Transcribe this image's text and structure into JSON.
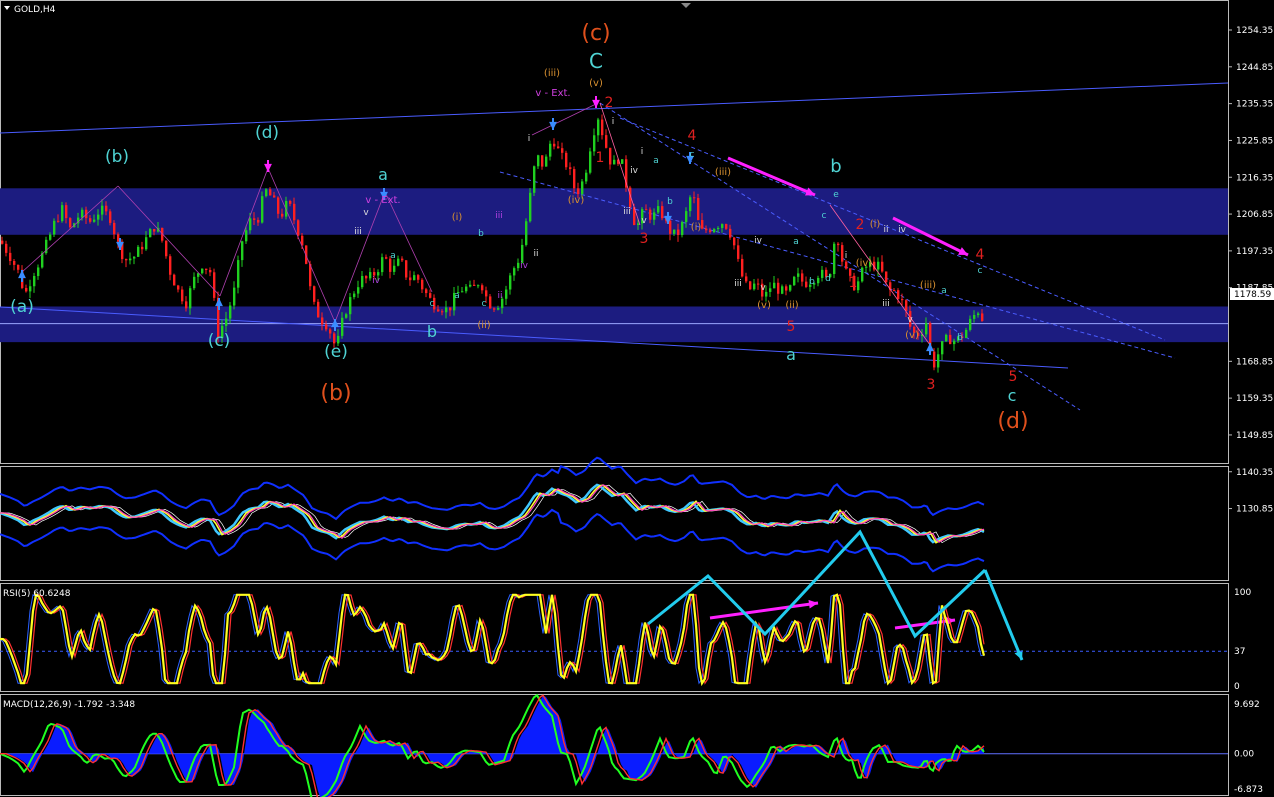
{
  "window": {
    "symbol_label": "GOLD,H4",
    "current_price_label": "1178.59"
  },
  "colors": {
    "background": "#000000",
    "bull_candle": "#20d020",
    "bear_candle": "#ff2020",
    "zone": "#1c1c80",
    "channel": "#4a5cff",
    "arrow_magenta": "#ff20ff",
    "arrow_cyan": "#22ccee",
    "label_cyan": "#4fd3d3",
    "label_orange": "#e0501c",
    "label_red": "#e02020",
    "label_gold": "#d89030",
    "rsi_line": "#ffff20",
    "macd_hist": "#0a1cff"
  },
  "chart_data": [
    {
      "type": "candlestick",
      "panel": "main",
      "symbol": "GOLD",
      "timeframe": "H4",
      "price_ticks": [
        "1254.35",
        "1244.85",
        "1235.35",
        "1225.85",
        "1216.35",
        "1206.85",
        "1197.35",
        "1187.85",
        "1178.59",
        "1168.85",
        "1159.35",
        "1149.85",
        "1140.35",
        "1130.85"
      ],
      "ylim": [
        1130.85,
        1259.0
      ],
      "current_price": 1178.59,
      "close_path": [
        [
          0,
          1200
        ],
        [
          10,
          1196
        ],
        [
          18,
          1192
        ],
        [
          25,
          1186
        ],
        [
          32,
          1191
        ],
        [
          40,
          1195
        ],
        [
          48,
          1200
        ],
        [
          55,
          1205
        ],
        [
          62,
          1208
        ],
        [
          70,
          1203
        ],
        [
          80,
          1207
        ],
        [
          90,
          1205
        ],
        [
          100,
          1208
        ],
        [
          110,
          1206
        ],
        [
          118,
          1199
        ],
        [
          125,
          1195
        ],
        [
          135,
          1196
        ],
        [
          145,
          1200
        ],
        [
          155,
          1204
        ],
        [
          162,
          1200
        ],
        [
          170,
          1192
        ],
        [
          178,
          1187
        ],
        [
          186,
          1184
        ],
        [
          194,
          1190
        ],
        [
          202,
          1194
        ],
        [
          210,
          1192
        ],
        [
          218,
          1176
        ],
        [
          226,
          1180
        ],
        [
          234,
          1187
        ],
        [
          242,
          1200
        ],
        [
          250,
          1205
        ],
        [
          258,
          1206
        ],
        [
          265,
          1213
        ],
        [
          272,
          1211
        ],
        [
          280,
          1206
        ],
        [
          288,
          1210
        ],
        [
          296,
          1204
        ],
        [
          304,
          1198
        ],
        [
          312,
          1184
        ],
        [
          320,
          1180
        ],
        [
          328,
          1178
        ],
        [
          336,
          1172
        ],
        [
          344,
          1181
        ],
        [
          352,
          1186
        ],
        [
          360,
          1190
        ],
        [
          368,
          1190
        ],
        [
          376,
          1192
        ],
        [
          384,
          1196
        ],
        [
          392,
          1192
        ],
        [
          400,
          1195
        ],
        [
          408,
          1190
        ],
        [
          416,
          1191
        ],
        [
          424,
          1187
        ],
        [
          432,
          1184
        ],
        [
          440,
          1183
        ],
        [
          448,
          1182
        ],
        [
          456,
          1186
        ],
        [
          464,
          1188
        ],
        [
          472,
          1187
        ],
        [
          480,
          1190
        ],
        [
          488,
          1184
        ],
        [
          496,
          1183
        ],
        [
          504,
          1186
        ],
        [
          512,
          1192
        ],
        [
          520,
          1196
        ],
        [
          528,
          1208
        ],
        [
          536,
          1222
        ],
        [
          544,
          1219
        ],
        [
          552,
          1227
        ],
        [
          560,
          1222
        ],
        [
          568,
          1219
        ],
        [
          576,
          1212
        ],
        [
          584,
          1216
        ],
        [
          592,
          1227
        ],
        [
          598,
          1232
        ],
        [
          604,
          1226
        ],
        [
          612,
          1219
        ],
        [
          620,
          1222
        ],
        [
          628,
          1212
        ],
        [
          636,
          1203
        ],
        [
          644,
          1208
        ],
        [
          652,
          1206
        ],
        [
          660,
          1208
        ],
        [
          668,
          1203
        ],
        [
          676,
          1201
        ],
        [
          684,
          1205
        ],
        [
          692,
          1213
        ],
        [
          700,
          1202
        ],
        [
          708,
          1203
        ],
        [
          716,
          1204
        ],
        [
          724,
          1205
        ],
        [
          732,
          1201
        ],
        [
          740,
          1192
        ],
        [
          748,
          1187
        ],
        [
          756,
          1189
        ],
        [
          764,
          1185
        ],
        [
          772,
          1189
        ],
        [
          780,
          1187
        ],
        [
          788,
          1186
        ],
        [
          796,
          1191
        ],
        [
          804,
          1189
        ],
        [
          812,
          1190
        ],
        [
          820,
          1192
        ],
        [
          828,
          1189
        ],
        [
          836,
          1203
        ],
        [
          842,
          1195
        ],
        [
          848,
          1190
        ],
        [
          856,
          1188
        ],
        [
          864,
          1193
        ],
        [
          872,
          1194
        ],
        [
          880,
          1193
        ],
        [
          888,
          1187
        ],
        [
          896,
          1187
        ],
        [
          904,
          1183
        ],
        [
          912,
          1176
        ],
        [
          920,
          1176
        ],
        [
          926,
          1179
        ],
        [
          932,
          1167
        ],
        [
          940,
          1172
        ],
        [
          948,
          1175
        ],
        [
          956,
          1174
        ],
        [
          964,
          1176
        ],
        [
          972,
          1180
        ],
        [
          978,
          1182
        ],
        [
          984,
          1179
        ]
      ],
      "zones": [
        [
          1201.5,
          1213.5
        ],
        [
          1173.8,
          1183.0
        ]
      ],
      "wave_labels_cyan": [
        "(a)",
        "(b)",
        "(c)",
        "(d)",
        "(e)",
        "a",
        "b",
        "C",
        "b",
        "a",
        "c"
      ],
      "wave_labels_orange": [
        "(c)",
        "(b)",
        "(d)"
      ],
      "wave_labels_red": [
        "2",
        "1",
        "3",
        "4",
        "5",
        "2",
        "1",
        "4",
        "3",
        "5"
      ],
      "wave_labels_gold": [
        "(iii)",
        "(v)",
        "(iv)",
        "(i)",
        "(ii)",
        "(i)",
        "(iii)",
        "(v)",
        "(ii)",
        "(i)",
        "(iv)",
        "(iii)",
        "(v)"
      ],
      "wave_labels_magenta": [
        "v - Ext.",
        "v - Ext."
      ],
      "wave_labels_small": [
        "i",
        "ii",
        "iii",
        "iv",
        "v",
        "a",
        "b",
        "c",
        "d",
        "e"
      ]
    },
    {
      "type": "line",
      "panel": "moving_averages",
      "series": []
    },
    {
      "type": "line",
      "panel": "rsi",
      "label": "RSI(5) 60.6248",
      "ylim": [
        0,
        100
      ],
      "ticks": [
        "100",
        "37",
        "0"
      ],
      "level": 37,
      "current": 60.6248
    },
    {
      "type": "bar",
      "panel": "macd",
      "label": "MACD(12,26,9) -1.792 -3.348",
      "ticks": [
        "9.692",
        "0.00",
        "-6.873"
      ],
      "ylim": [
        -6.873,
        9.692
      ],
      "main": -1.792,
      "signal": -3.348
    }
  ]
}
